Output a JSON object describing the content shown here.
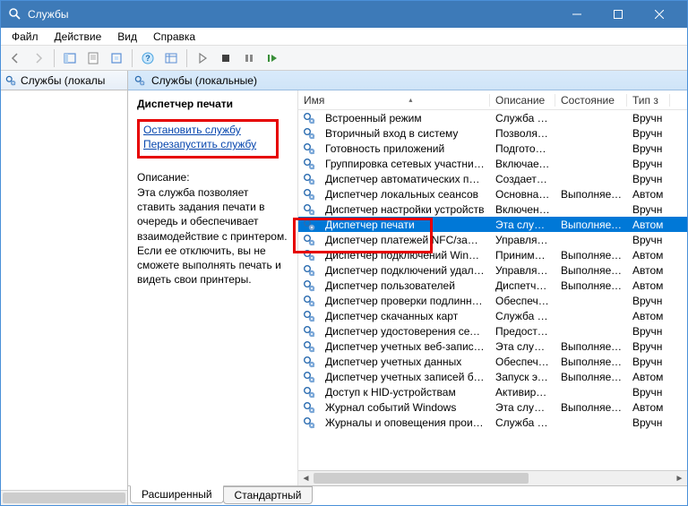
{
  "window": {
    "title": "Службы"
  },
  "menu": {
    "file": "Файл",
    "action": "Действие",
    "view": "Вид",
    "help": "Справка"
  },
  "left": {
    "title": "Службы (локалы"
  },
  "pane": {
    "title": "Службы (локальные)"
  },
  "detail": {
    "heading": "Диспетчер печати",
    "stop": "Остановить",
    "restart": "Перезапустить",
    "service_word": "службу",
    "desc_label": "Описание:",
    "desc": "Эта служба позволяет ставить задания печати в очередь и обеспечивает взаимодействие с принтером. Если ее отключить, вы не сможете выполнять печать и видеть свои принтеры."
  },
  "columns": {
    "name": "Имя",
    "desc": "Описание",
    "state": "Состояние",
    "type": "Тип з"
  },
  "services": [
    {
      "name": "Встроенный режим",
      "desc": "Служба \"В...",
      "state": "",
      "type": "Вручн"
    },
    {
      "name": "Вторичный вход в систему",
      "desc": "Позволяет...",
      "state": "",
      "type": "Вручн"
    },
    {
      "name": "Готовность приложений",
      "desc": "Подготовк...",
      "state": "",
      "type": "Вручн"
    },
    {
      "name": "Группировка сетевых участников",
      "desc": "Включает...",
      "state": "",
      "type": "Вручн"
    },
    {
      "name": "Диспетчер автоматических подключ...",
      "desc": "Создает п...",
      "state": "",
      "type": "Вручн"
    },
    {
      "name": "Диспетчер локальных сеансов",
      "desc": "Основная ...",
      "state": "Выполняется",
      "type": "Автом"
    },
    {
      "name": "Диспетчер настройки устройств",
      "desc": "Включени...",
      "state": "",
      "type": "Вручн"
    },
    {
      "name": "Диспетчер печати",
      "desc": "Эта служб...",
      "state": "Выполняется",
      "type": "Автом",
      "selected": true
    },
    {
      "name": "Диспетчер платежей NFC/защище...",
      "desc": "Управляет...",
      "state": "",
      "type": "Вручн"
    },
    {
      "name": "Диспетчер подключений Windows",
      "desc": "Принимае...",
      "state": "Выполняется",
      "type": "Автом"
    },
    {
      "name": "Диспетчер подключений удаленного...",
      "desc": "Управляет...",
      "state": "Выполняется",
      "type": "Автом"
    },
    {
      "name": "Диспетчер пользователей",
      "desc": "Диспетчер...",
      "state": "Выполняется",
      "type": "Автом"
    },
    {
      "name": "Диспетчер проверки подлинности X...",
      "desc": "Обеспечи...",
      "state": "",
      "type": "Вручн"
    },
    {
      "name": "Диспетчер скачанных карт",
      "desc": "Служба W...",
      "state": "",
      "type": "Автом"
    },
    {
      "name": "Диспетчер удостоверения сетевых уч...",
      "desc": "Предостав...",
      "state": "",
      "type": "Вручн"
    },
    {
      "name": "Диспетчер учетных веб-записей",
      "desc": "Эта служб...",
      "state": "Выполняется",
      "type": "Вручн"
    },
    {
      "name": "Диспетчер учетных данных",
      "desc": "Обеспечи...",
      "state": "Выполняется",
      "type": "Вручн"
    },
    {
      "name": "Диспетчер учетных записей безопасн...",
      "desc": "Запуск это...",
      "state": "Выполняется",
      "type": "Автом"
    },
    {
      "name": "Доступ к HID-устройствам",
      "desc": "Активируе...",
      "state": "",
      "type": "Вручн"
    },
    {
      "name": "Журнал событий Windows",
      "desc": "Эта служб...",
      "state": "Выполняется",
      "type": "Автом"
    },
    {
      "name": "Журналы и оповещения производите...",
      "desc": "Служба ж...",
      "state": "",
      "type": "Вручн"
    }
  ],
  "tabs": {
    "extended": "Расширенный",
    "standard": "Стандартный"
  }
}
